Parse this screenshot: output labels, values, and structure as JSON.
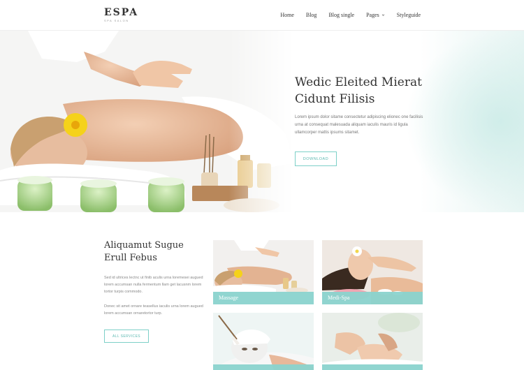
{
  "header": {
    "logo": "ESPA",
    "tagline": "SPA SALON",
    "nav": [
      "Home",
      "Blog",
      "Blog single",
      "Pages",
      "Styleguide"
    ]
  },
  "hero": {
    "title": "Wedic Eleited Mierat Cidunt Filisis",
    "text": "Lorem ipsum dolor sitame consectetur adipiscing elionec one facilisis urna at consequat malesuada aliquam iaculis mauris id ligula ullamcorper mattis ipsums sitamet.",
    "button": "DOWNLOAD"
  },
  "services": {
    "title": "Aliquamut Sugue Erull Febus",
    "text1": "Sed id ultrices lectnc ut finib aculis urna loremesei augued lorem accumsan nulla fermentum llam get lacusnm lorem tortor turpis commodo.",
    "text2": "Donec sit amet ornare teasellus iaculis urna lorem augued lorem accumsan ornaretortor turp.",
    "button": "ALL SERVICES",
    "cards": [
      "Massage",
      "Medi-Spa",
      "",
      ""
    ]
  },
  "colors": {
    "accent": "#7dd0c8",
    "card_label_bg": "#8ad3cd"
  }
}
